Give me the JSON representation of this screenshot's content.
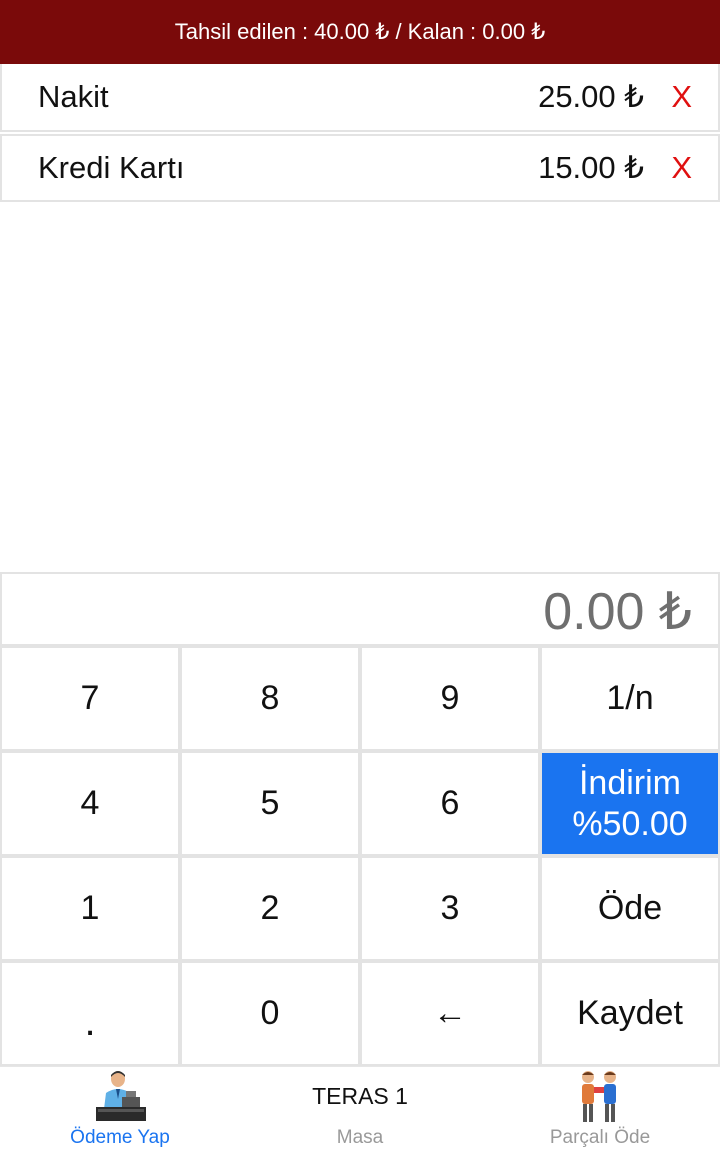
{
  "header": {
    "text": "Tahsil edilen : 40.00 ₺ / Kalan : 0.00 ₺"
  },
  "payments": [
    {
      "name": "Nakit",
      "amount": "25.00 ₺",
      "remove": "X"
    },
    {
      "name": "Kredi Kartı",
      "amount": "15.00 ₺",
      "remove": "X"
    }
  ],
  "display": {
    "value": "0.00 ₺"
  },
  "keypad": {
    "k7": "7",
    "k8": "8",
    "k9": "9",
    "split": "1/n",
    "k4": "4",
    "k5": "5",
    "k6": "6",
    "discount_line1": "İndirim",
    "discount_line2": "%50.00",
    "k1": "1",
    "k2": "2",
    "k3": "3",
    "pay": "Öde",
    "dot": ".",
    "k0": "0",
    "backspace": "←",
    "save": "Kaydet"
  },
  "nav": {
    "pay_label": "Ödeme Yap",
    "table_title": "TERAS 1",
    "table_label": "Masa",
    "split_label": "Parçalı Öde"
  },
  "colors": {
    "header_bg": "#7a0a0a",
    "remove": "#e01010",
    "accent": "#1a74f0"
  },
  "icons": {
    "pay": "cashier-icon",
    "split": "people-exchange-icon"
  }
}
